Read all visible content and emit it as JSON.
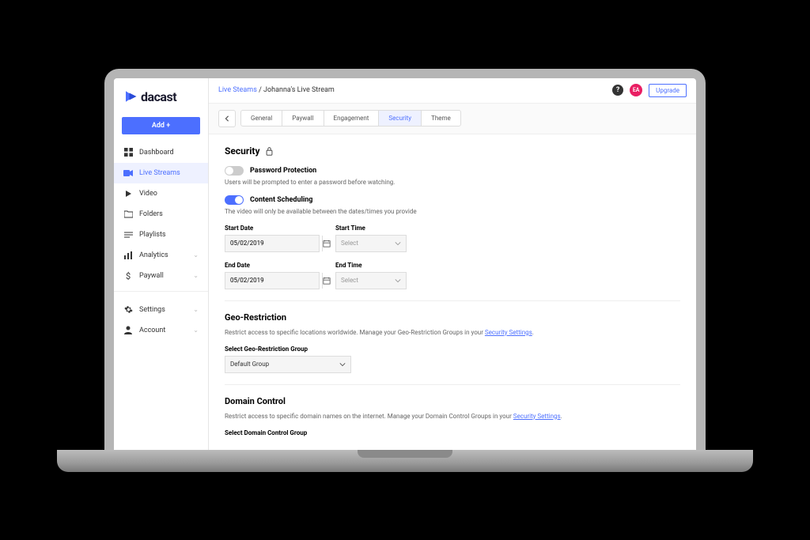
{
  "logo": {
    "text": "dacast"
  },
  "sidebar": {
    "add_label": "Add +",
    "items": [
      {
        "label": "Dashboard"
      },
      {
        "label": "Live Streams"
      },
      {
        "label": "Video"
      },
      {
        "label": "Folders"
      },
      {
        "label": "Playlists"
      },
      {
        "label": "Analytics"
      },
      {
        "label": "Paywall"
      },
      {
        "label": "Settings"
      },
      {
        "label": "Account"
      }
    ]
  },
  "breadcrumb": {
    "parent": "Live Steams",
    "current": "Johanna's Live Stream"
  },
  "topbar": {
    "avatar": "EA",
    "upgrade": "Upgrade"
  },
  "tabs": {
    "items": [
      {
        "label": "General"
      },
      {
        "label": "Paywall"
      },
      {
        "label": "Engagement"
      },
      {
        "label": "Security"
      },
      {
        "label": "Theme"
      }
    ]
  },
  "security": {
    "title": "Security",
    "password": {
      "label": "Password Protection",
      "desc": "Users will be prompted to enter a password before watching."
    },
    "scheduling": {
      "label": "Content Scheduling",
      "desc": "The video will only be available between the dates/times you provide"
    },
    "start_date_label": "Start Date",
    "start_date_value": "05/02/2019",
    "start_time_label": "Start Time",
    "start_time_placeholder": "Select",
    "end_date_label": "End Date",
    "end_date_value": "05/02/2019",
    "end_time_label": "End Time",
    "end_time_placeholder": "Select"
  },
  "geo": {
    "title": "Geo-Restriction",
    "desc": "Restrict access to specific locations worldwide. Manage your Geo-Restriction Groups in your ",
    "link": "Security Settings",
    "select_label": "Select Geo-Restriction Group",
    "select_value": "Default Group"
  },
  "domain": {
    "title": "Domain Control",
    "desc": "Restrict access to specific domain names on the internet. Manage your Domain Control Groups in your ",
    "link": "Security Settings",
    "select_label": "Select Domain Control Group"
  }
}
